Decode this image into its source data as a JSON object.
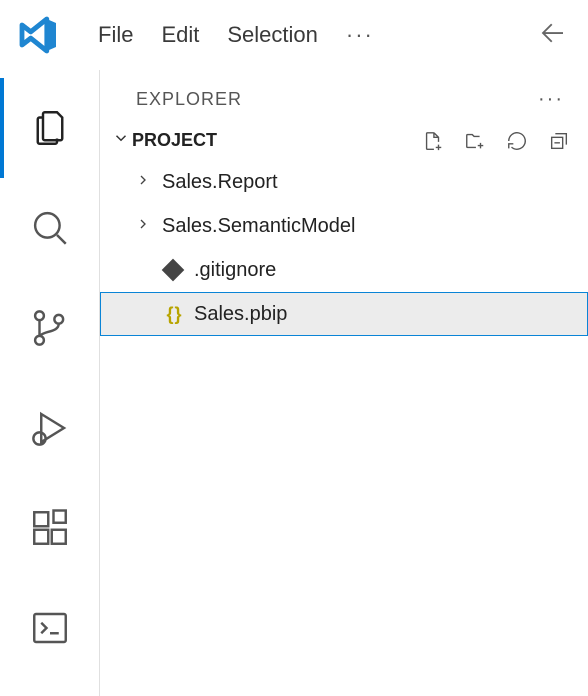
{
  "app": {
    "menu": {
      "file": "File",
      "edit": "Edit",
      "selection": "Selection"
    }
  },
  "explorer": {
    "title": "EXPLORER",
    "section": {
      "label": "PROJECT",
      "items": [
        {
          "label": "Sales.Report",
          "type": "folder",
          "expanded": false,
          "selected": false
        },
        {
          "label": "Sales.SemanticModel",
          "type": "folder",
          "expanded": false,
          "selected": false
        },
        {
          "label": ".gitignore",
          "type": "file",
          "icon": "git",
          "selected": false
        },
        {
          "label": "Sales.pbip",
          "type": "file",
          "icon": "braces",
          "selected": true
        }
      ]
    }
  }
}
